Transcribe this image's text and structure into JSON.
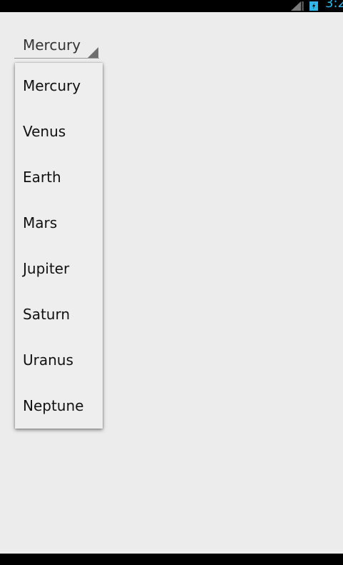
{
  "status_bar": {
    "time": "3:2",
    "signal_icon": "signal-icon",
    "battery_icon": "battery-icon",
    "accent_color": "#33b5e5"
  },
  "spinner": {
    "selected": "Mercury"
  },
  "dropdown": {
    "items": [
      {
        "label": "Mercury"
      },
      {
        "label": "Venus"
      },
      {
        "label": "Earth"
      },
      {
        "label": "Mars"
      },
      {
        "label": "Jupiter"
      },
      {
        "label": "Saturn"
      },
      {
        "label": "Uranus"
      },
      {
        "label": "Neptune"
      }
    ]
  }
}
